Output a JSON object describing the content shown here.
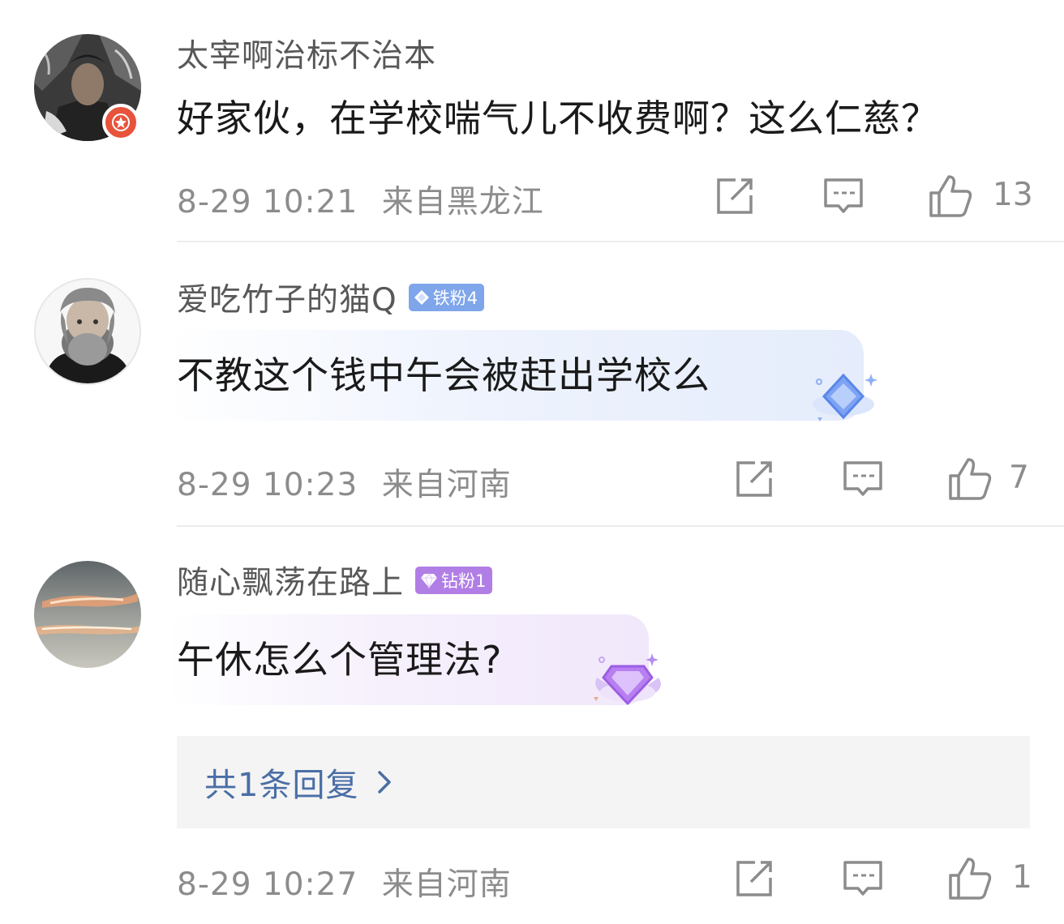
{
  "comments": [
    {
      "username": "太宰啊治标不治本",
      "badge": null,
      "content": "好家伙，在学校喘气儿不收费啊？这么仁慈？",
      "date": "8-29 10:21",
      "location": "来自黑龙江",
      "likes": "13",
      "icons": {
        "share": "share-icon",
        "comment": "comment-icon",
        "like": "thumbs-up-icon"
      }
    },
    {
      "username": "爱吃竹子的猫Q",
      "badge": "铁粉4",
      "content": "不教这个钱中午会被赶出学校么",
      "date": "8-29 10:23",
      "location": "来自河南",
      "likes": "7",
      "icons": {
        "share": "share-icon",
        "comment": "comment-icon",
        "like": "thumbs-up-icon"
      }
    },
    {
      "username": "随心飘荡在路上",
      "badge": "钻粉1",
      "content": "午休怎么个管理法?",
      "reply_summary": "共1条回复",
      "date": "8-29 10:27",
      "location": "来自河南",
      "likes": "1",
      "icons": {
        "share": "share-icon",
        "comment": "comment-icon",
        "like": "thumbs-up-icon"
      }
    }
  ],
  "colors": {
    "username": "#585858",
    "meta": "#8c8c8c",
    "reply_link": "#4a6ea6",
    "iron_badge": "#7fa5ea",
    "diamond_badge": "#b17ee6"
  }
}
